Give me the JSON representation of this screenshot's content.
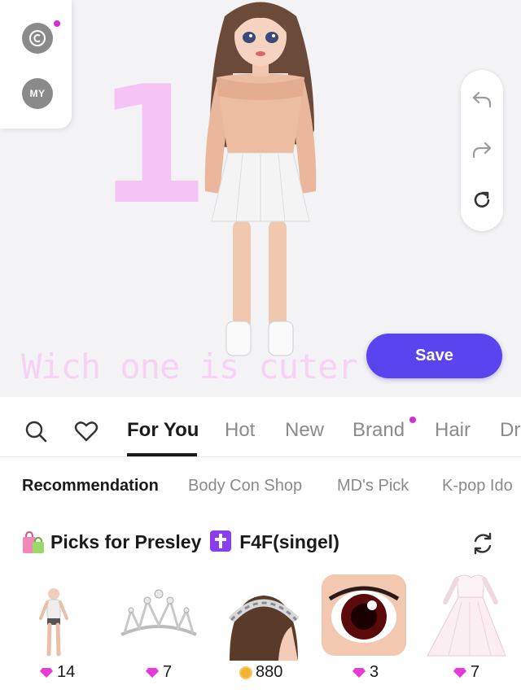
{
  "side_panel": {
    "my_label": "MY"
  },
  "overlay": {
    "big_number": "1.",
    "caption": "Wich one is cuter"
  },
  "actions": {
    "save_label": "Save"
  },
  "tabs": [
    {
      "label": "For You",
      "active": true
    },
    {
      "label": "Hot",
      "active": false
    },
    {
      "label": "New",
      "active": false
    },
    {
      "label": "Brand",
      "active": false,
      "dot": true
    },
    {
      "label": "Hair",
      "active": false
    },
    {
      "label": "Dr",
      "active": false
    }
  ],
  "subtabs": [
    {
      "label": "Recommendation",
      "active": true
    },
    {
      "label": "Body Con Shop",
      "active": false
    },
    {
      "label": "MD's Pick",
      "active": false
    },
    {
      "label": "K-pop Ido",
      "active": false
    }
  ],
  "section": {
    "title_prefix": "Picks for Presley",
    "title_suffix": "F4F(singel)"
  },
  "items": [
    {
      "icon": "body-mannequin-icon",
      "currency": "gem",
      "price": "14"
    },
    {
      "icon": "tiara-icon",
      "currency": "gem",
      "price": "7"
    },
    {
      "icon": "headband-icon",
      "currency": "coin",
      "price": "880"
    },
    {
      "icon": "eyes-icon",
      "currency": "gem",
      "price": "3"
    },
    {
      "icon": "wedding-dress-icon",
      "currency": "gem",
      "price": "7"
    }
  ],
  "colors": {
    "accent": "#5a44f0",
    "pink_text": "#f6c4f4",
    "notif_dot": "#d52ed8",
    "gem": "#e83ad8",
    "coin": "#f4b233"
  }
}
